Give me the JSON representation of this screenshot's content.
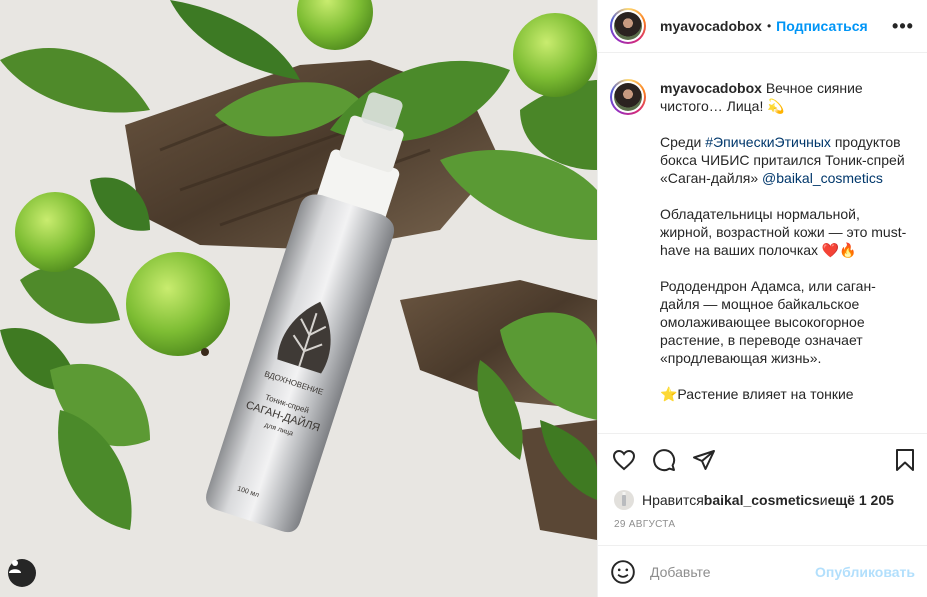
{
  "header": {
    "username": "myavocadobox",
    "separator": "•",
    "follow_label": "Подписаться",
    "more_label": "•••"
  },
  "caption": {
    "username": "myavocadobox",
    "line1": "Вечное сияние чистого… Лица! 💫",
    "p2_before": "Среди ",
    "p2_hashtag": "#ЭпическиЭтичных",
    "p2_after": " продуктов бокса ЧИБИС притаился Тоник-спрей «Саган-дайля» ",
    "p2_mention": "@baikal_cosmetics",
    "p3": "Обладательницы нормальной, жирной, возрастной кожи — это must-have на ваших полочках ❤️🔥",
    "p4": "Рододендрон Адамса, или саган-дайля — мощное байкальское омолаживающее высокогорное растение, в переводе означает «продлевающая жизнь».",
    "p5": "⭐Растение влияет на тонкие"
  },
  "actions": {
    "like_icon": "heart-outline-icon",
    "comment_icon": "speech-bubble-icon",
    "share_icon": "paper-plane-icon",
    "save_icon": "bookmark-icon"
  },
  "likes": {
    "prefix": "Нравится ",
    "user": "baikal_cosmetics",
    "middle": " и ",
    "others": "ещё 1 205"
  },
  "date": "29 АВГУСТА",
  "comment": {
    "placeholder": "Добавьте",
    "publish_label": "Опубликовать"
  },
  "product": {
    "brand": "ВДОХНОВЕНИЕ",
    "type": "Тоник-спрей",
    "name": "САГАН-ДАЙЛЯ",
    "sub": "для лица",
    "volume": "100 мл"
  },
  "colors": {
    "accent": "#0095f6",
    "link": "#00376b",
    "muted": "#8e8e8e",
    "publish_disabled": "#b2dffc"
  }
}
